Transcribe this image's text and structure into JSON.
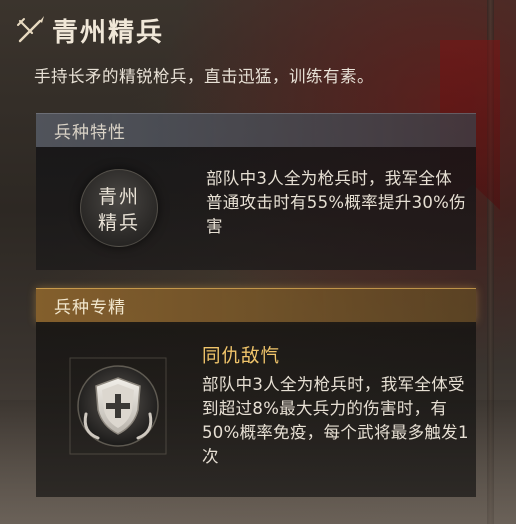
{
  "header": {
    "title": "青州精兵",
    "icon": "crossed-spear-icon",
    "subtitle": "手持长矛的精锐枪兵，直击迅猛，训练有素。"
  },
  "trait": {
    "heading": "兵种特性",
    "badge_line1": "青州",
    "badge_line2": "精兵",
    "description": "部队中3人全为枪兵时，我军全体普通攻击时有55%概率提升30%伤害"
  },
  "specialty": {
    "heading": "兵种专精",
    "skill_name": "同仇敌忾",
    "skill_icon": "shield-plus-icon",
    "description": "部队中3人全为枪兵时，我军全体受到超过8%最大兵力的伤害时，有50%概率免疫，每个武将最多触发1次"
  },
  "colors": {
    "skill_name": "#f0c46a",
    "specialty_header": "#8c642d",
    "trait_header": "#565a64"
  }
}
